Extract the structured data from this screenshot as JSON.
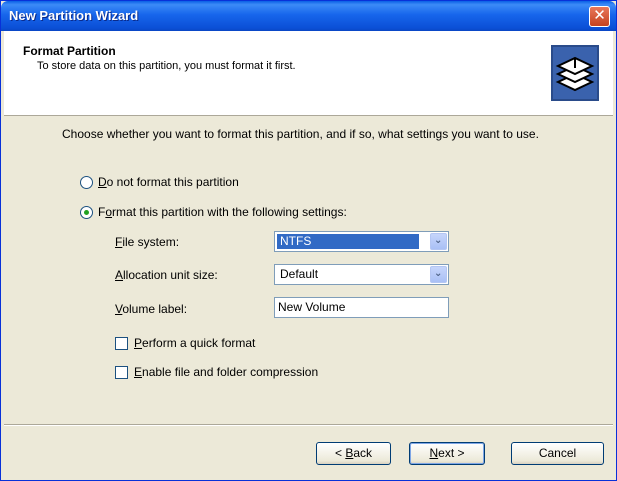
{
  "window": {
    "title": "New Partition Wizard"
  },
  "header": {
    "title": "Format Partition",
    "subtitle": "To store data on this partition, you must format it first."
  },
  "intro": "Choose whether you want to format this partition, and if so, what settings you want to use.",
  "options": {
    "no_format": {
      "label": "Do not format this partition",
      "checked": false
    },
    "format": {
      "label": "Format this partition with the following settings:",
      "checked": true
    }
  },
  "settings": {
    "file_system": {
      "label": "File system:",
      "value": "NTFS"
    },
    "allocation_unit": {
      "label": "Allocation unit size:",
      "value": "Default"
    },
    "volume_label": {
      "label": "Volume label:",
      "value": "New Volume"
    }
  },
  "checkboxes": {
    "quick_format": {
      "label": "Perform a quick format",
      "checked": false
    },
    "compression": {
      "label": "Enable file and folder compression",
      "checked": false
    }
  },
  "buttons": {
    "back": "< Back",
    "next": "Next >",
    "cancel": "Cancel"
  },
  "icons": {
    "close": "close-icon",
    "header": "format-disk-icon",
    "dropdown": "chevron-down-icon"
  },
  "colors": {
    "title_bar": "#0a5fe6",
    "selection": "#316ac5",
    "dialog_bg": "#ece9d8",
    "close_button": "#d34f2b"
  }
}
